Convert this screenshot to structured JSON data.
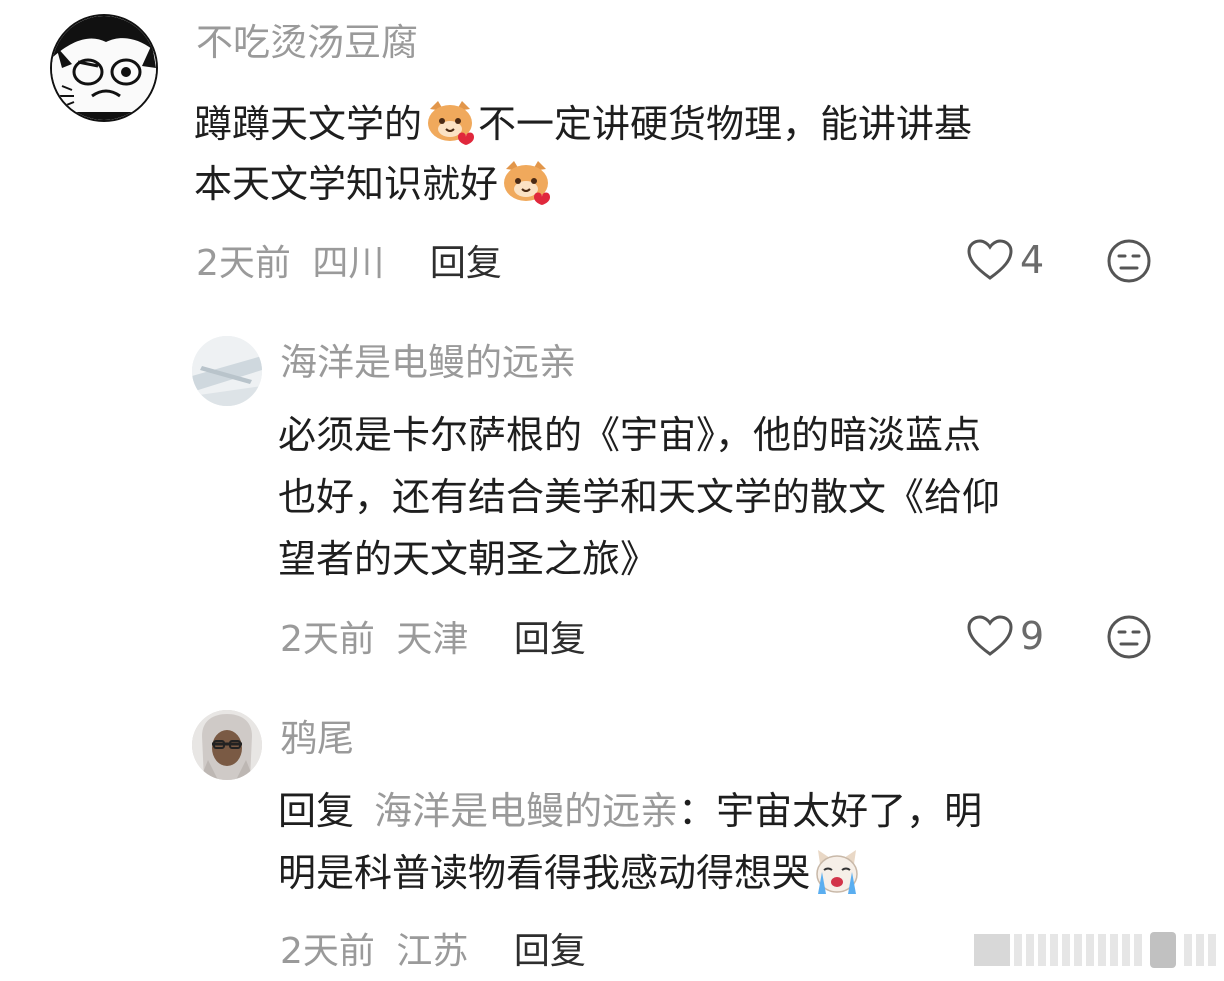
{
  "comments": [
    {
      "username": "不吃烫汤豆腐",
      "lines": [
        {
          "a": "蹲蹲天文学的",
          "b": "不一定讲硬货物理，能讲讲基"
        },
        {
          "a": "本天文学知识就好",
          "b": ""
        }
      ],
      "time": "2天前",
      "location": "四川",
      "reply_label": "回复",
      "likes": "4",
      "emoji_icon": "cat-heart-emoji-icon"
    },
    {
      "username": "海洋是电鳗的远亲",
      "lines": [
        "必须是卡尔萨根的《宇宙》，他的暗淡蓝点",
        "也好，还有结合美学和天文学的散文《给仰",
        "望者的天文朝圣之旅》"
      ],
      "time": "2天前",
      "location": "天津",
      "reply_label": "回复",
      "likes": "9"
    },
    {
      "username": "鸦尾",
      "reply_prefix": "回复",
      "reply_target": "海洋是电鳗的远亲",
      "line1_rest": "：宇宙太好了，明",
      "line2": "明是科普读物看得我感动得想哭",
      "time": "2天前",
      "location": "江苏",
      "reply_label": "回复",
      "emoji_icon": "crying-dog-emoji-icon"
    }
  ],
  "colors": {
    "text": "#1e1e1e",
    "muted": "#9a9a9a",
    "background": "#ffffff"
  }
}
